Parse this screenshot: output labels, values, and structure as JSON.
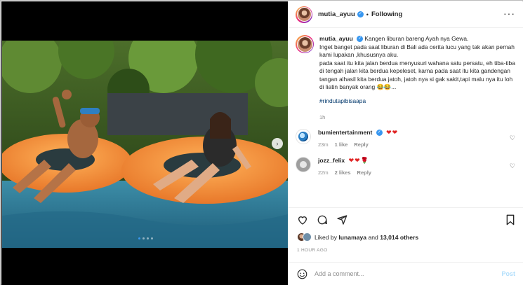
{
  "colors": {
    "accent": "#3897f0",
    "heart": "#e02424",
    "hashtag": "#00376b",
    "muted": "#8e8e8e"
  },
  "header": {
    "username": "mutia_ayuu",
    "separator": "•",
    "follow_label": "Following",
    "more_icon": "more-horizontal-icon"
  },
  "caption": {
    "username": "mutia_ayuu",
    "line1": "Kangen liburan bareng Ayah nya Gewa.",
    "line2": "Inget banget pada saat liburan di Bali ada cerita lucu yang tak akan pernah kami lupakan ,khususnya aku.",
    "line3": "pada saat itu kita jalan berdua menyusuri wahana satu persatu, eh tiba-tiba di tengah jalan kita berdua kepeleset, karna pada saat itu kita gandengan tangan alhasil kita berdua jatoh, jatoh nya si gak sakit,tapi malu nya itu loh di liatin banyak orang 😂😂...",
    "hashtag": "#rindutapibisaapa",
    "time": "1h"
  },
  "comments": [
    {
      "username": "bumientertainment",
      "emoji": "❤❤",
      "time": "23m",
      "likes": "1 like",
      "reply": "Reply"
    },
    {
      "username": "jozz_felix",
      "emoji": "❤❤🌹",
      "time": "22m",
      "likes": "2 likes",
      "reply": "Reply"
    }
  ],
  "likes": {
    "prefix": "Liked by",
    "user": "lunamaya",
    "middle": "and",
    "others": "13,014 others"
  },
  "post_time": "1 HOUR AGO",
  "add_comment": {
    "placeholder": "Add a comment...",
    "post_label": "Post"
  },
  "carousel": {
    "slide_count": 4,
    "current": 1
  }
}
